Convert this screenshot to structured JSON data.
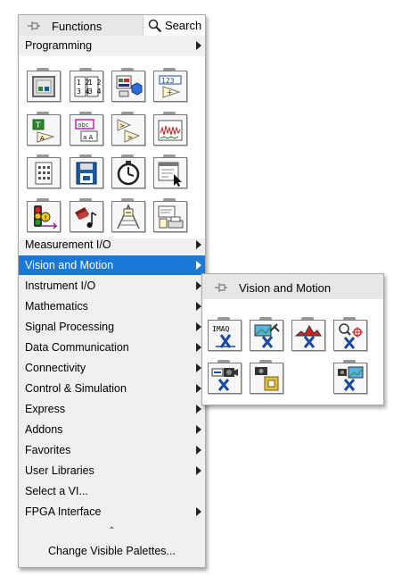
{
  "palette": {
    "title": "Functions",
    "search_label": "Search",
    "header_item": "Programming",
    "icons": [
      {
        "name": "structures-icon"
      },
      {
        "name": "array-icon"
      },
      {
        "name": "cluster-class-variant-icon"
      },
      {
        "name": "numeric-icon"
      },
      {
        "name": "boolean-icon"
      },
      {
        "name": "string-icon"
      },
      {
        "name": "comparison-icon"
      },
      {
        "name": "timing-waveform-icon"
      },
      {
        "name": "dialog-ui-icon"
      },
      {
        "name": "file-io-icon"
      },
      {
        "name": "timing-icon"
      },
      {
        "name": "application-control-icon"
      },
      {
        "name": "synchronization-icon"
      },
      {
        "name": "graphics-sound-icon"
      },
      {
        "name": "report-generation-icon"
      },
      {
        "name": "print-report-icon"
      }
    ],
    "menu_items": [
      {
        "label": "Measurement I/O",
        "arrow": true
      },
      {
        "label": "Vision and Motion",
        "arrow": true,
        "selected": true
      },
      {
        "label": "Instrument I/O",
        "arrow": true
      },
      {
        "label": "Mathematics",
        "arrow": true
      },
      {
        "label": "Signal Processing",
        "arrow": true
      },
      {
        "label": "Data Communication",
        "arrow": true
      },
      {
        "label": "Connectivity",
        "arrow": true
      },
      {
        "label": "Control & Simulation",
        "arrow": true
      },
      {
        "label": "Express",
        "arrow": true
      },
      {
        "label": "Addons",
        "arrow": true
      },
      {
        "label": "Favorites",
        "arrow": true
      },
      {
        "label": "User Libraries",
        "arrow": true
      },
      {
        "label": "Select a VI...",
        "arrow": false
      },
      {
        "label": "FPGA Interface",
        "arrow": true
      }
    ],
    "collapse_symbol": "⌃",
    "change_palettes": "Change Visible Palettes..."
  },
  "subpalette": {
    "title": "Vision and Motion",
    "icon_text_imaq": "IMAQ",
    "icons": [
      {
        "name": "imaq-icon"
      },
      {
        "name": "vision-utilities-icon"
      },
      {
        "name": "image-processing-icon"
      },
      {
        "name": "machine-vision-icon"
      },
      {
        "name": "vision-acquisition-icon"
      },
      {
        "name": "motion-icon"
      },
      {
        "name": "vision-express-icon"
      }
    ]
  },
  "colors": {
    "selection": "#1a78d6",
    "panel": "#f0f0f0",
    "title_bar": "#e7e7e7"
  }
}
